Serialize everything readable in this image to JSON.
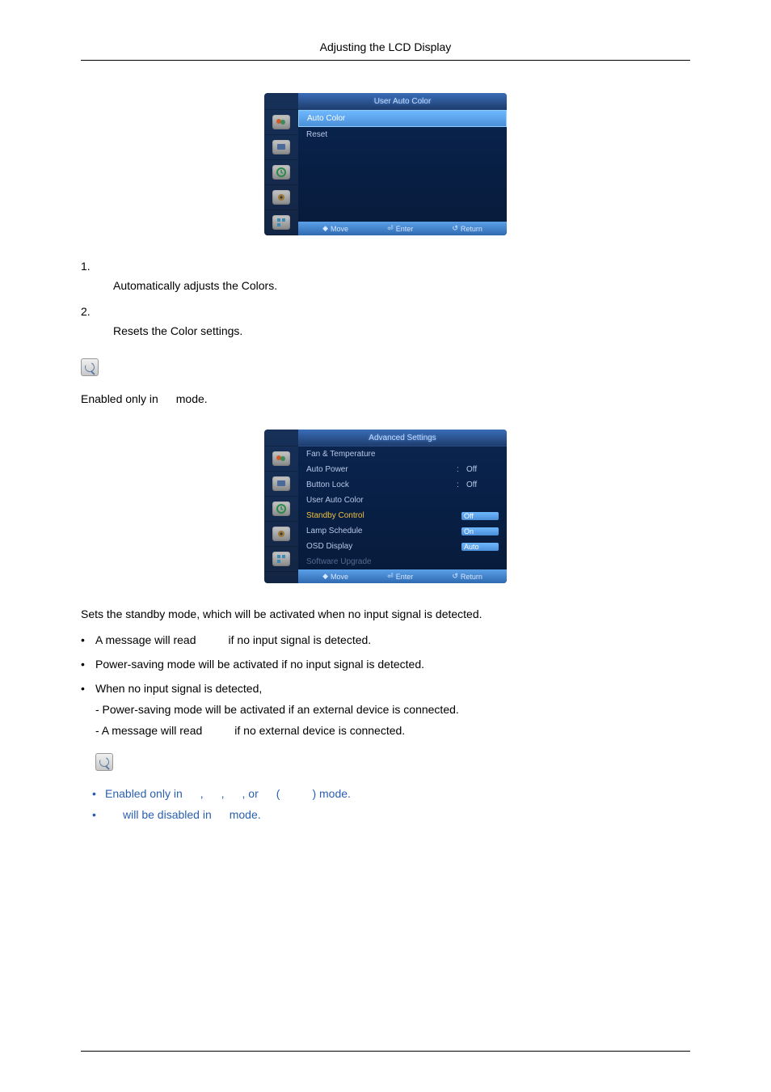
{
  "header": {
    "title": "Adjusting the LCD Display"
  },
  "osd1": {
    "title": "User Auto Color",
    "items": [
      {
        "label": "Auto Color",
        "selected": true
      },
      {
        "label": "Reset",
        "selected": false
      }
    ],
    "footer": {
      "move": "Move",
      "enter": "Enter",
      "return": "Return"
    }
  },
  "list1": {
    "n1": "1.",
    "n1_text": "Automatically adjusts the Colors.",
    "n2": "2.",
    "n2_text": "Resets the Color settings."
  },
  "note1": {
    "prefix": "Enabled only in",
    "suffix": "mode."
  },
  "osd2": {
    "title": "Advanced Settings",
    "items": [
      {
        "label": "Fan & Temperature",
        "value": "",
        "selected": false
      },
      {
        "label": "Auto Power",
        "value": "Off",
        "selected": false,
        "colon": ":"
      },
      {
        "label": "Button Lock",
        "value": "Off",
        "selected": false,
        "colon": ":"
      },
      {
        "label": "User Auto Color",
        "value": "",
        "selected": false
      },
      {
        "label": "Standby Control",
        "value": "Off",
        "selected": true,
        "hl": true
      },
      {
        "label": "Lamp Schedule",
        "value": "On",
        "selected": false,
        "hl": true
      },
      {
        "label": "OSD Display",
        "value": "Auto",
        "selected": false,
        "hl": true
      },
      {
        "label": "Software Upgrade",
        "value": "",
        "selected": false,
        "disabled": true
      }
    ],
    "footer": {
      "move": "Move",
      "enter": "Enter",
      "return": "Return"
    }
  },
  "para1": "Sets the standby mode, which will be activated when no input signal is detected.",
  "bullets": {
    "b1a": "A message will read",
    "b1b": "if no input signal is detected.",
    "b2": "Power-saving mode will be activated if no input signal is detected.",
    "b3a": "When no input signal is detected,",
    "b3b": "- Power-saving mode will be activated if an external device is connected.",
    "b3c_pre": "- A message will read",
    "b3c_post": "if no external device is connected."
  },
  "notes2": {
    "l1_a": "Enabled only in",
    "l1_b": ",",
    "l1_c": ",",
    "l1_d": ", or",
    "l1_e": "(",
    "l1_f": ") mode.",
    "l2_a": "will be disabled in",
    "l2_b": "mode."
  }
}
